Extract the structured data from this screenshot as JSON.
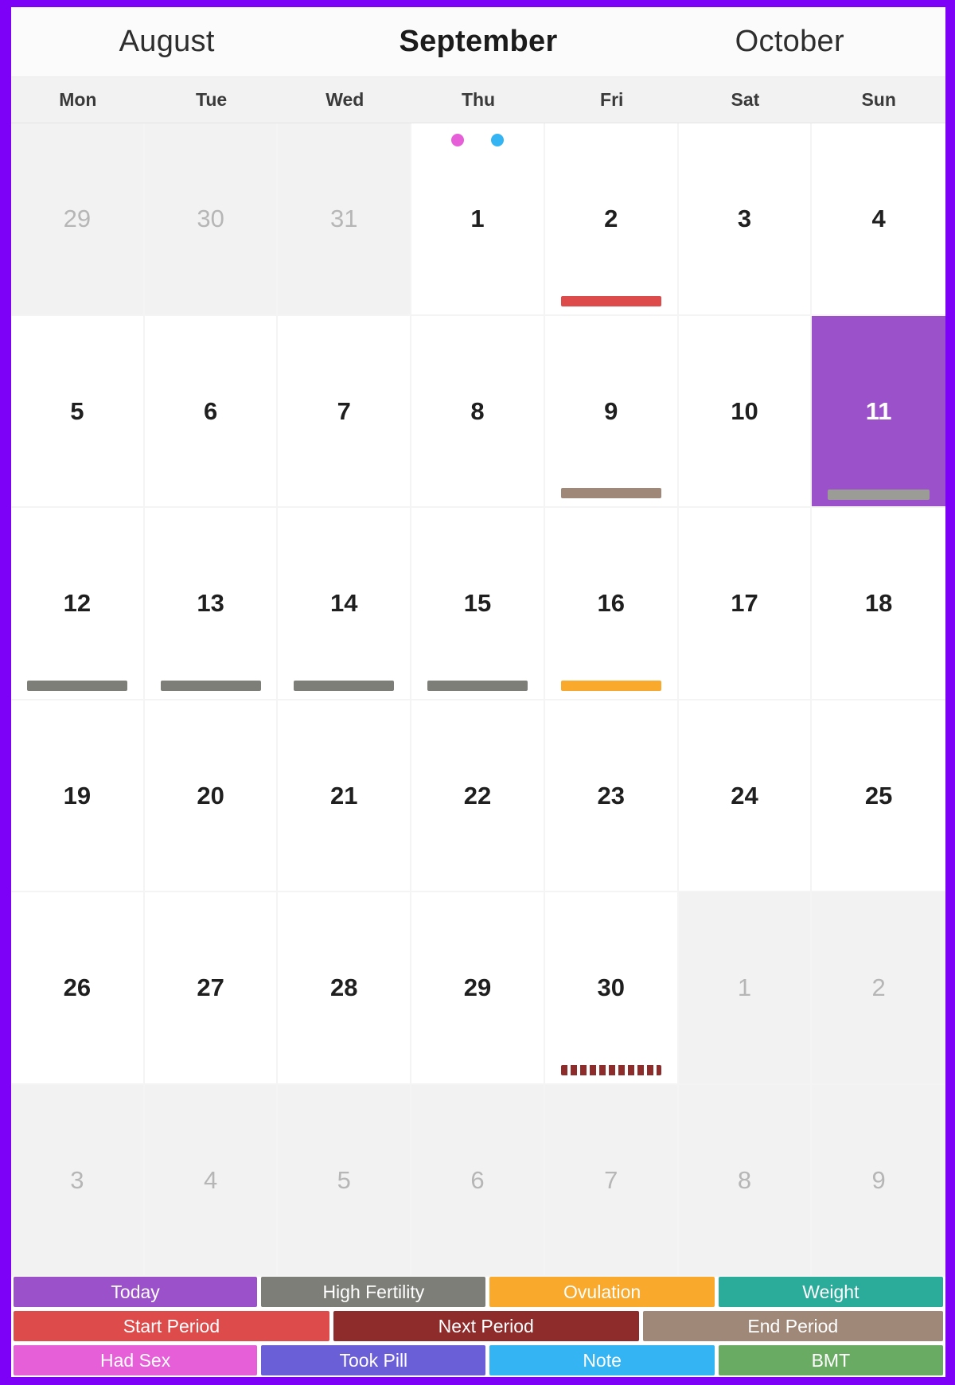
{
  "header": {
    "months": [
      {
        "name": "August",
        "current": false
      },
      {
        "name": "September",
        "current": true
      },
      {
        "name": "October",
        "current": false
      }
    ]
  },
  "weekdays": [
    "Mon",
    "Tue",
    "Wed",
    "Thu",
    "Fri",
    "Sat",
    "Sun"
  ],
  "colors": {
    "app_border": "#7d00f7",
    "today": "#9b51c9",
    "high_fertility": "#7e7e78",
    "ovulation": "#f9a92c",
    "weight": "#2bab9a",
    "start_period": "#dd4b4b",
    "next_period": "#8e2b2b",
    "end_period": "#a08878",
    "had_sex": "#e65fd8",
    "took_pill": "#6b5fd8",
    "note": "#34b4f2",
    "bmt": "#6aab63",
    "other_month_bg": "#f2f2f2",
    "grid_line": "#f4f4f4"
  },
  "weeks": [
    [
      {
        "num": "29",
        "other_month": true
      },
      {
        "num": "30",
        "other_month": true
      },
      {
        "num": "31",
        "other_month": true
      },
      {
        "num": "1",
        "dots": [
          "#e65fd8",
          "#34b4f2"
        ]
      },
      {
        "num": "2",
        "bar": "#dd4b4b",
        "bar_label": "Start Period"
      },
      {
        "num": "3"
      },
      {
        "num": "4"
      }
    ],
    [
      {
        "num": "5"
      },
      {
        "num": "6"
      },
      {
        "num": "7"
      },
      {
        "num": "8"
      },
      {
        "num": "9",
        "bar": "#a08878",
        "bar_label": "End Period"
      },
      {
        "num": "10"
      },
      {
        "num": "11",
        "today": true,
        "bar": "#9c9c97",
        "bar_label": "High Fertility"
      }
    ],
    [
      {
        "num": "12",
        "bar": "#7e7e78",
        "bar_label": "High Fertility"
      },
      {
        "num": "13",
        "bar": "#7e7e78",
        "bar_label": "High Fertility"
      },
      {
        "num": "14",
        "bar": "#7e7e78",
        "bar_label": "High Fertility"
      },
      {
        "num": "15",
        "bar": "#7e7e78",
        "bar_label": "High Fertility"
      },
      {
        "num": "16",
        "bar": "#f9a92c",
        "bar_label": "Ovulation"
      },
      {
        "num": "17"
      },
      {
        "num": "18"
      }
    ],
    [
      {
        "num": "19"
      },
      {
        "num": "20"
      },
      {
        "num": "21"
      },
      {
        "num": "22"
      },
      {
        "num": "23"
      },
      {
        "num": "24"
      },
      {
        "num": "25"
      }
    ],
    [
      {
        "num": "26"
      },
      {
        "num": "27"
      },
      {
        "num": "28"
      },
      {
        "num": "29"
      },
      {
        "num": "30",
        "bar_dashed": true,
        "bar_label": "Next Period"
      },
      {
        "num": "1",
        "other_month": true
      },
      {
        "num": "2",
        "other_month": true
      }
    ],
    [
      {
        "num": "3",
        "other_month": true
      },
      {
        "num": "4",
        "other_month": true
      },
      {
        "num": "5",
        "other_month": true
      },
      {
        "num": "6",
        "other_month": true
      },
      {
        "num": "7",
        "other_month": true
      },
      {
        "num": "8",
        "other_month": true
      },
      {
        "num": "9",
        "other_month": true
      }
    ]
  ],
  "legend": {
    "rows": [
      [
        {
          "label": "Today",
          "color": "#9b51c9",
          "flex": 2.3
        },
        {
          "label": "High Fertility",
          "color": "#7e7e78",
          "flex": 2.12
        },
        {
          "label": "Ovulation",
          "color": "#f9a92c",
          "flex": 2.12
        },
        {
          "label": "Weight",
          "color": "#2bab9a",
          "flex": 2.12
        }
      ],
      [
        {
          "label": "Start Period",
          "color": "#dd4b4b",
          "flex": 3.05
        },
        {
          "label": "Next Period",
          "color": "#8e2b2b",
          "flex": 2.95
        },
        {
          "label": "End Period",
          "color": "#a08878",
          "flex": 2.9
        }
      ],
      [
        {
          "label": "Had Sex",
          "color": "#e65fd8",
          "flex": 2.3
        },
        {
          "label": "Took Pill",
          "color": "#6b5fd8",
          "flex": 2.12
        },
        {
          "label": "Note",
          "color": "#34b4f2",
          "flex": 2.12
        },
        {
          "label": "BMT",
          "color": "#6aab63",
          "flex": 2.12
        }
      ]
    ]
  }
}
